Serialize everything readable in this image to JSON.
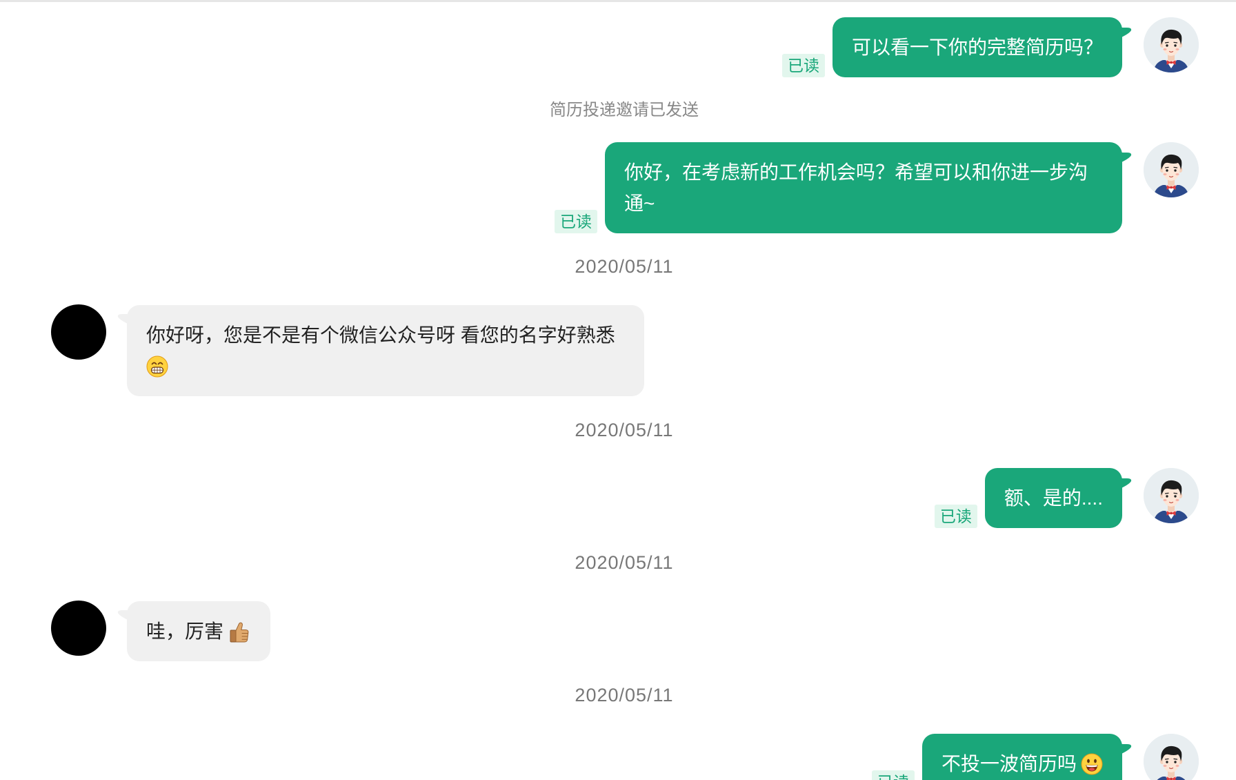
{
  "colors": {
    "page_bg": "#ffffff",
    "divider": "#e6e6e6",
    "sent_bubble": "#1aa77a",
    "sent_text": "#ffffff",
    "received_bubble": "#f0f0f0",
    "received_text": "#222222",
    "read_badge_bg": "#e2f6ed",
    "read_badge_text": "#1aa77a",
    "timestamp_text": "#777777",
    "notice_text": "#888888",
    "contact_avatar": "#000000",
    "avatar_bg": "#e8eef1"
  },
  "thread": [
    {
      "sender_avatar": "recruiter-avatar-icon",
      "text": "可以看一下你的完整简历吗？",
      "read_status": "已读"
    },
    {
      "notice": "简历投递邀请已发送"
    },
    {
      "sender_avatar": "recruiter-avatar-icon",
      "text": "你好，在考虑新的工作机会吗？希望可以和你进一步沟通~",
      "read_status": "已读"
    },
    {
      "timestamp": "2020/05/11"
    },
    {
      "sender_avatar": "contact-avatar-icon",
      "text": "你好呀，您是不是有个微信公众号呀 看您的名字好熟悉",
      "emoji": "beaming-face-icon"
    },
    {
      "timestamp": "2020/05/11"
    },
    {
      "sender_avatar": "recruiter-avatar-icon",
      "text": "额、是的....",
      "read_status": "已读"
    },
    {
      "timestamp": "2020/05/11"
    },
    {
      "sender_avatar": "contact-avatar-icon",
      "text": "哇，厉害",
      "emoji": "thumbs-up-icon"
    },
    {
      "timestamp": "2020/05/11"
    },
    {
      "sender_avatar": "recruiter-avatar-icon",
      "text": "不投一波简历吗",
      "emoji": "grinning-face-icon",
      "read_status": "已读"
    }
  ]
}
